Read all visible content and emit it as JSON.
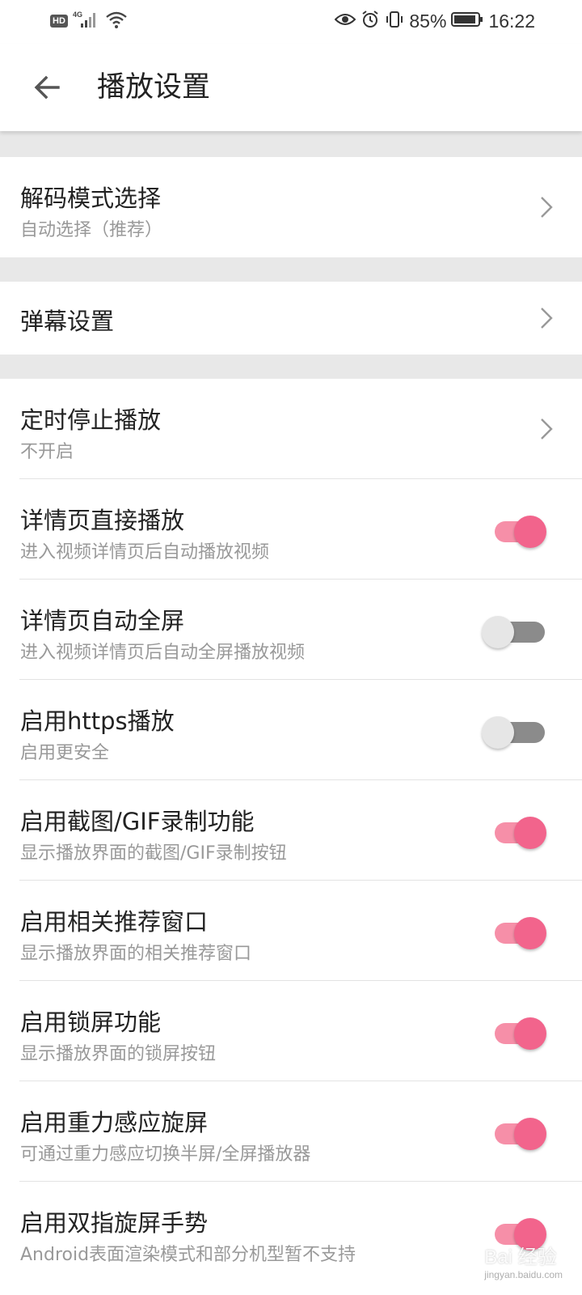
{
  "status_bar": {
    "network_badge": "HD",
    "network_type": "4G",
    "battery_percent": "85%",
    "time": "16:22"
  },
  "app_bar": {
    "title": "播放设置"
  },
  "settings": {
    "decode_mode": {
      "title": "解码模式选择",
      "subtitle": "自动选择（推荐）"
    },
    "danmaku": {
      "title": "弹幕设置"
    },
    "sleep_timer": {
      "title": "定时停止播放",
      "subtitle": "不开启"
    },
    "detail_autoplay": {
      "title": "详情页直接播放",
      "subtitle": "进入视频详情页后自动播放视频",
      "enabled": true
    },
    "detail_fullscreen": {
      "title": "详情页自动全屏",
      "subtitle": "进入视频详情页后自动全屏播放视频",
      "enabled": false
    },
    "https_play": {
      "title": "启用https播放",
      "subtitle": "启用更安全",
      "enabled": false
    },
    "screenshot_gif": {
      "title": "启用截图/GIF录制功能",
      "subtitle": "显示播放界面的截图/GIF录制按钮",
      "enabled": true
    },
    "related_window": {
      "title": "启用相关推荐窗口",
      "subtitle": "显示播放界面的相关推荐窗口",
      "enabled": true
    },
    "lock_screen": {
      "title": "启用锁屏功能",
      "subtitle": "显示播放界面的锁屏按钮",
      "enabled": true
    },
    "gravity_rotate": {
      "title": "启用重力感应旋屏",
      "subtitle": "可通过重力感应切换半屏/全屏播放器",
      "enabled": true
    },
    "two_finger_rotate": {
      "title": "启用双指旋屏手势",
      "subtitle": "Android表面渲染模式和部分机型暂不支持",
      "enabled": true
    }
  },
  "watermark": {
    "text": "Bai 经验",
    "url": "jingyan.baidu.com"
  },
  "colors": {
    "toggle_on_thumb": "#f2648c",
    "toggle_on_track": "#f68fa8",
    "toggle_off_thumb": "#e6e6e6",
    "toggle_off_track": "#8b8b8b",
    "section_gap": "#e8e8e8"
  }
}
